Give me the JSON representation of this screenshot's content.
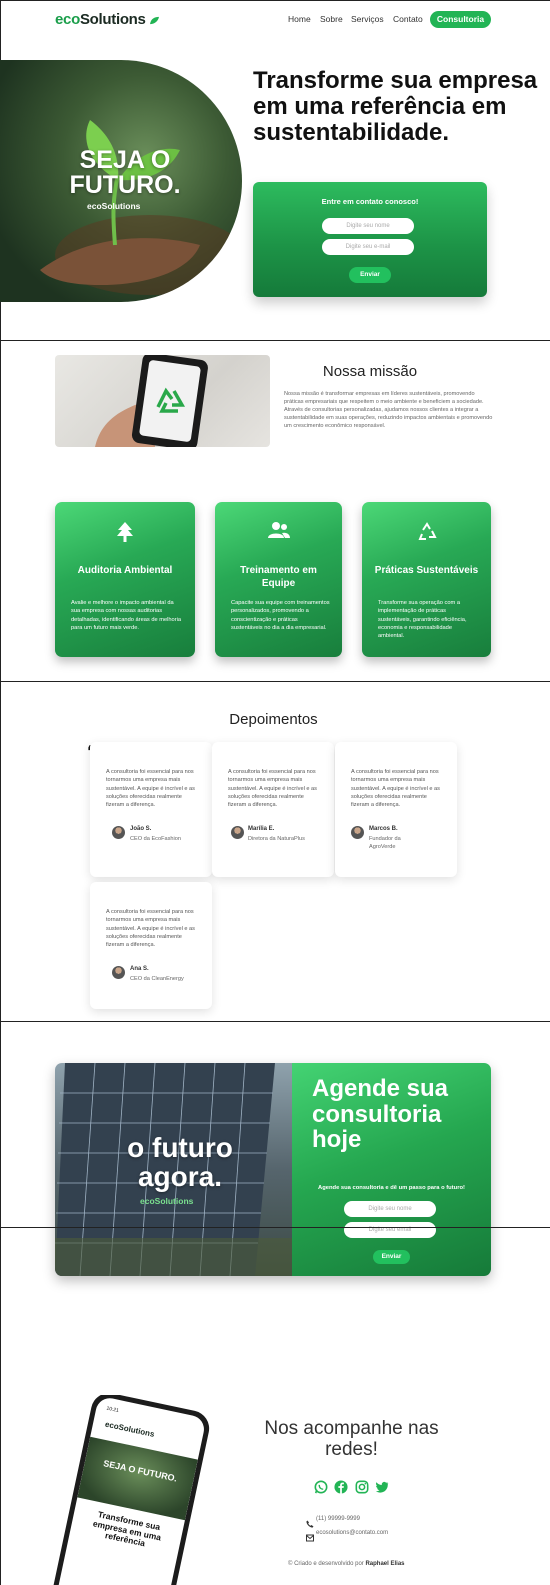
{
  "header": {
    "logo_eco": "eco",
    "logo_solutions": "Solutions",
    "nav": [
      "Home",
      "Sobre",
      "Serviços",
      "Contato"
    ],
    "cta": "Consultoria"
  },
  "hero": {
    "image_text_line1": "SEJA O",
    "image_text_line2": "FUTURO.",
    "image_logo": "ecoSolutions",
    "title": "Transforme sua empresa em uma referência em sustentabilidade.",
    "form_title": "Entre em contato conosco!",
    "name_placeholder": "Digite seu nome",
    "email_placeholder": "Digite seu e-mail",
    "send": "Enviar"
  },
  "mission": {
    "title": "Nossa missão",
    "text": "Nossa missão é transformar empresas em líderes sustentáveis, promovendo práticas empresariais que respeitem o meio ambiente e beneficiem a sociedade. Através de consultorias personalizadas, ajudamos nossos clientes a integrar a sustentabilidade em suas operações, reduzindo impactos ambientais e promovendo um crescimento econômico responsável."
  },
  "services": [
    {
      "icon": "tree-icon",
      "title": "Auditoria Ambiental",
      "text": "Avalie e melhore o impacto ambiental da sua empresa com nossas auditorias detalhadas, identificando áreas de melhoria para um futuro mais verde."
    },
    {
      "icon": "users-icon",
      "title": "Treinamento em Equipe",
      "text": "Capacite sua equipe com treinamentos personalizados, promovendo a conscientização e práticas sustentáveis no dia a dia empresarial."
    },
    {
      "icon": "recycle-icon",
      "title": "Práticas Sustentáveis",
      "text": "Transforme sua operação com a implementação de práticas sustentáveis, garantindo eficiência, economia e responsabilidade ambiental."
    }
  ],
  "testimonials": {
    "title": "Depoimentos",
    "quote_mark": "❝",
    "items": [
      {
        "text": "A consultoria foi essencial para nos tornarmos uma empresa mais sustentável. A equipe é incrível e as soluções oferecidas realmente fizeram a diferença.",
        "name": "João S.",
        "role": "CEO da EcoFashion"
      },
      {
        "text": "A consultoria foi essencial para nos tornarmos uma empresa mais sustentável. A equipe é incrível e as soluções oferecidas realmente fizeram a diferença.",
        "name": "Marília E.",
        "role": "Diretora da NaturaPlus"
      },
      {
        "text": "A consultoria foi essencial para nos tornarmos uma empresa mais sustentável. A equipe é incrível e as soluções oferecidas realmente fizeram a diferença.",
        "name": "Marcos B.",
        "role": "Fundador da AgroVerde"
      },
      {
        "text": "A consultoria foi essencial para nos tornarmos uma empresa mais sustentável. A equipe é incrível e as soluções oferecidas realmente fizeram a diferença.",
        "name": "Ana S.",
        "role": "CEO da CleanEnergy"
      }
    ]
  },
  "cta": {
    "image_line1": "o futuro",
    "image_line2": "agora.",
    "image_logo": "ecoSolutions",
    "title": "Agende sua consultoria hoje",
    "subtitle": "Agende sua consultoria e dê um passo para o futuro!",
    "name_placeholder": "Digite seu nome",
    "email_placeholder": "Digite seu email",
    "send": "Enviar"
  },
  "footer": {
    "title": "Nos acompanhe nas redes!",
    "phone": "(11) 99999-9999",
    "email": "ecosolutions@contato.com",
    "credit_prefix": "© Criado e desenvolvido por ",
    "credit_name": "Raphael Elias",
    "phone_mock": {
      "time": "10:21",
      "logo": "ecoSolutions",
      "hero_text": "SEJA O FUTURO.",
      "title": "Transforme sua empresa em uma referência"
    }
  },
  "colors": {
    "brand": "#22b455",
    "dark_green": "#157a3a"
  }
}
